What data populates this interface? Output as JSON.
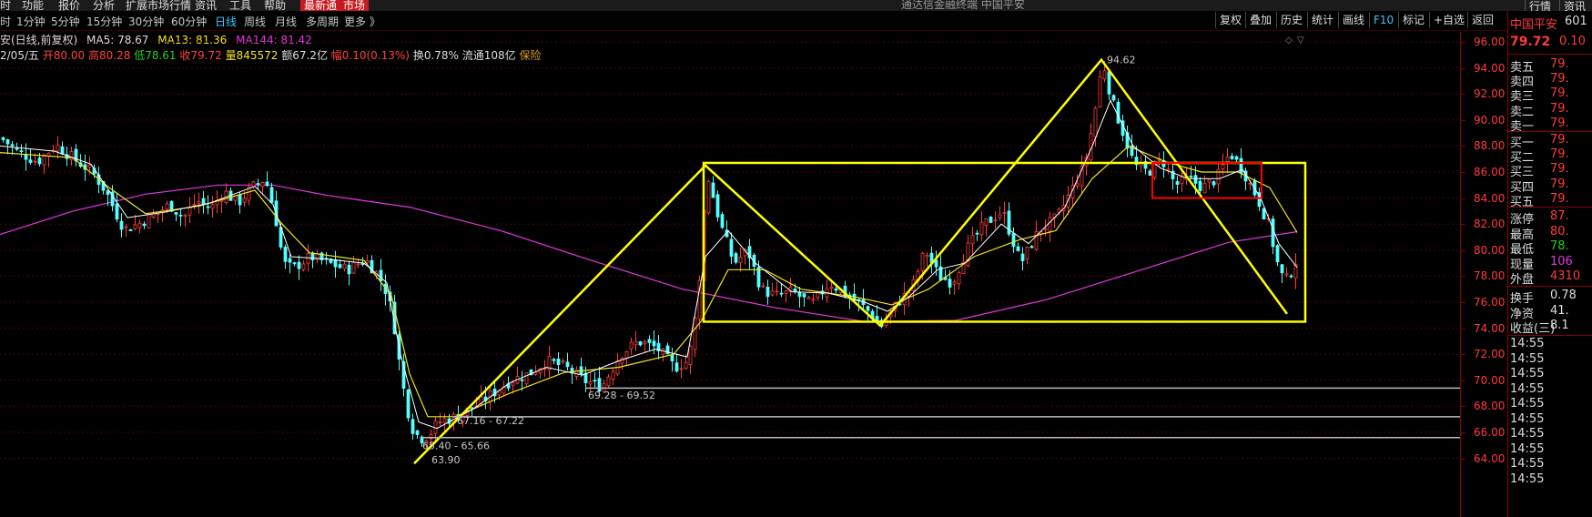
{
  "menubar": {
    "items": [
      "时",
      "功能",
      "报价",
      "分析",
      "扩展市场行情",
      "资讯",
      "工具",
      "帮助"
    ],
    "red_items": [
      "最新通",
      "市场"
    ],
    "window_title": "通达信金融终端 中国平安",
    "right_buttons": [
      "行情",
      "资讯"
    ]
  },
  "toolbar": {
    "periods": [
      "时",
      "1分钟",
      "5分钟",
      "15分钟",
      "30分钟",
      "60分钟",
      "日线",
      "周线",
      "月线",
      "多周期",
      "更多 》"
    ],
    "active_period": "日线",
    "buttons": [
      "复权",
      "叠加",
      "历史",
      "统计",
      "画线",
      "F10",
      "标记",
      "+自选",
      "返回"
    ],
    "f10_color": "#3fc4ff"
  },
  "info_line1": {
    "stock": "安(日线,前复权)",
    "ma5": "MA5: 78.67",
    "ma13": "MA13: 81.36",
    "ma144": "MA144: 81.42"
  },
  "info_line2": {
    "date": "2/05/五",
    "open": "开80.00",
    "high": "高80.28",
    "low": "低78.61",
    "close": "收79.72",
    "volume": "量845572",
    "amount": "额67.2亿",
    "change": "幅0.10(0.13%)",
    "turnover": "换0.78%",
    "float": "流通108亿",
    "sector": "保险"
  },
  "y_axis": {
    "labels": [
      "96.00",
      "94.00",
      "92.00",
      "90.00",
      "88.00",
      "86.00",
      "84.00",
      "82.00",
      "80.00",
      "78.00",
      "76.00",
      "74.00",
      "72.00",
      "70.00",
      "68.00",
      "66.00",
      "64.00"
    ]
  },
  "annotations": {
    "peak": "94.62",
    "range1": "69.28 - 69.52",
    "range2": "67.16 - 67.22",
    "range3": "65.40 - 65.66",
    "low": "63.90"
  },
  "panel": {
    "name": "中国平安",
    "code": "601",
    "price": "79.72",
    "change": "0.10",
    "order_book": [
      {
        "k": "卖五",
        "v": "79."
      },
      {
        "k": "卖四",
        "v": "79."
      },
      {
        "k": "卖三",
        "v": "79."
      },
      {
        "k": "卖二",
        "v": "79."
      },
      {
        "k": "卖一",
        "v": "79."
      },
      {
        "k": "买一",
        "v": "79."
      },
      {
        "k": "买二",
        "v": "79."
      },
      {
        "k": "买三",
        "v": "79."
      },
      {
        "k": "买四",
        "v": "79."
      },
      {
        "k": "买五",
        "v": "79."
      }
    ],
    "stats": [
      {
        "k": "涨停",
        "v": "87."
      },
      {
        "k": "最高",
        "v": "80."
      },
      {
        "k": "最低",
        "v": "78."
      },
      {
        "k": "现量",
        "v": "106"
      },
      {
        "k": "外盘",
        "v": "4310"
      }
    ],
    "stats2": [
      {
        "k": "换手",
        "v": "0.78"
      },
      {
        "k": "净资",
        "v": "41."
      },
      {
        "k": "收益(三)",
        "v": "8.1"
      }
    ],
    "ticks": [
      "14:55",
      "14:55",
      "14:55",
      "14:55",
      "14:55",
      "14:55",
      "14:55",
      "14:55",
      "14:55",
      "14:55"
    ]
  },
  "colors": {
    "background": "#000000",
    "up": "#ff3b3b",
    "down": "#54ffff",
    "ma5": "#ffffff",
    "ma13": "#f2e51c",
    "ma144": "#e03ae0",
    "drawing": "#ffff00",
    "box_red": "#ff0000"
  },
  "chart_data": {
    "type": "candlestick",
    "title": "安(日线,前复权)",
    "ylim": [
      63.5,
      97.0
    ],
    "y_ticks": [
      96,
      94,
      92,
      90,
      88,
      86,
      84,
      82,
      80,
      78,
      76,
      74,
      72,
      70,
      68,
      66,
      64
    ],
    "grid": true,
    "series": [
      {
        "name": "MA5",
        "last": 78.67
      },
      {
        "name": "MA13",
        "last": 81.36
      },
      {
        "name": "MA144",
        "last": 81.42
      }
    ],
    "price_path": [
      [
        0,
        88.6
      ],
      [
        20,
        87.5
      ],
      [
        40,
        86.8
      ],
      [
        60,
        88.1
      ],
      [
        80,
        87.0
      ],
      [
        100,
        86.0
      ],
      [
        115,
        84.5
      ],
      [
        125,
        83.0
      ],
      [
        135,
        81.6
      ],
      [
        150,
        82.0
      ],
      [
        170,
        82.8
      ],
      [
        185,
        83.5
      ],
      [
        200,
        82.5
      ],
      [
        215,
        83.8
      ],
      [
        230,
        83.2
      ],
      [
        245,
        84.5
      ],
      [
        260,
        83.6
      ],
      [
        275,
        84.8
      ],
      [
        290,
        85.5
      ],
      [
        300,
        83.0
      ],
      [
        310,
        79.0
      ],
      [
        320,
        78.6
      ],
      [
        340,
        79.5
      ],
      [
        360,
        79.0
      ],
      [
        380,
        78.5
      ],
      [
        400,
        79.3
      ],
      [
        415,
        78.0
      ],
      [
        425,
        76.5
      ],
      [
        432,
        74.0
      ],
      [
        440,
        70.0
      ],
      [
        450,
        66.5
      ],
      [
        460,
        65.5
      ],
      [
        470,
        65.8
      ],
      [
        480,
        66.8
      ],
      [
        500,
        67.2
      ],
      [
        520,
        68.0
      ],
      [
        540,
        69.0
      ],
      [
        560,
        70.0
      ],
      [
        580,
        70.5
      ],
      [
        600,
        71.5
      ],
      [
        620,
        71.0
      ],
      [
        640,
        70.0
      ],
      [
        660,
        69.5
      ],
      [
        680,
        72.0
      ],
      [
        700,
        73.0
      ],
      [
        720,
        72.5
      ],
      [
        740,
        71.0
      ],
      [
        755,
        71.5
      ],
      [
        765,
        76.0
      ],
      [
        775,
        86.0
      ],
      [
        790,
        82.0
      ],
      [
        805,
        79.0
      ],
      [
        820,
        80.0
      ],
      [
        835,
        77.0
      ],
      [
        850,
        76.5
      ],
      [
        870,
        76.8
      ],
      [
        890,
        75.8
      ],
      [
        910,
        77.5
      ],
      [
        930,
        76.5
      ],
      [
        950,
        75.5
      ],
      [
        967,
        74.2
      ],
      [
        985,
        76.0
      ],
      [
        1000,
        77.0
      ],
      [
        1015,
        80.0
      ],
      [
        1030,
        78.0
      ],
      [
        1045,
        77.5
      ],
      [
        1060,
        80.0
      ],
      [
        1080,
        82.0
      ],
      [
        1100,
        83.0
      ],
      [
        1120,
        79.0
      ],
      [
        1140,
        81.5
      ],
      [
        1160,
        82.5
      ],
      [
        1175,
        84.5
      ],
      [
        1190,
        86.5
      ],
      [
        1200,
        90.0
      ],
      [
        1210,
        94.6
      ],
      [
        1220,
        91.5
      ],
      [
        1230,
        89.5
      ],
      [
        1245,
        86.5
      ],
      [
        1260,
        86.0
      ],
      [
        1275,
        87.0
      ],
      [
        1290,
        85.0
      ],
      [
        1305,
        85.5
      ],
      [
        1320,
        84.8
      ],
      [
        1335,
        85.5
      ],
      [
        1350,
        87.5
      ],
      [
        1365,
        86.0
      ],
      [
        1380,
        84.0
      ],
      [
        1392,
        82.0
      ],
      [
        1402,
        79.0
      ],
      [
        1410,
        77.5
      ],
      [
        1418,
        78.5
      ],
      [
        1425,
        79.72
      ]
    ],
    "ma5_path": [
      [
        0,
        88.0
      ],
      [
        60,
        87.6
      ],
      [
        100,
        86.6
      ],
      [
        140,
        82.5
      ],
      [
        180,
        82.9
      ],
      [
        230,
        83.6
      ],
      [
        280,
        84.9
      ],
      [
        300,
        83.5
      ],
      [
        320,
        79.5
      ],
      [
        360,
        79.3
      ],
      [
        400,
        79.0
      ],
      [
        425,
        77.5
      ],
      [
        440,
        72.0
      ],
      [
        460,
        66.8
      ],
      [
        480,
        66.3
      ],
      [
        520,
        67.8
      ],
      [
        560,
        69.8
      ],
      [
        600,
        71.0
      ],
      [
        640,
        70.4
      ],
      [
        680,
        71.5
      ],
      [
        720,
        72.4
      ],
      [
        755,
        71.8
      ],
      [
        775,
        79.5
      ],
      [
        800,
        81.5
      ],
      [
        830,
        79.0
      ],
      [
        870,
        76.8
      ],
      [
        910,
        76.7
      ],
      [
        950,
        76.0
      ],
      [
        975,
        75.3
      ],
      [
        1000,
        76.5
      ],
      [
        1030,
        78.5
      ],
      [
        1060,
        79.0
      ],
      [
        1100,
        82.0
      ],
      [
        1130,
        80.5
      ],
      [
        1170,
        83.3
      ],
      [
        1200,
        88.0
      ],
      [
        1220,
        91.5
      ],
      [
        1245,
        88.0
      ],
      [
        1275,
        86.3
      ],
      [
        1305,
        85.5
      ],
      [
        1340,
        85.5
      ],
      [
        1365,
        86.2
      ],
      [
        1385,
        84.0
      ],
      [
        1405,
        80.5
      ],
      [
        1425,
        78.67
      ]
    ],
    "ma13_path": [
      [
        0,
        87.5
      ],
      [
        80,
        87.1
      ],
      [
        120,
        84.8
      ],
      [
        160,
        82.8
      ],
      [
        220,
        83.4
      ],
      [
        280,
        84.6
      ],
      [
        310,
        82.0
      ],
      [
        340,
        79.8
      ],
      [
        400,
        79.2
      ],
      [
        430,
        76.5
      ],
      [
        450,
        70.5
      ],
      [
        470,
        67.2
      ],
      [
        500,
        67.2
      ],
      [
        560,
        69.0
      ],
      [
        620,
        70.6
      ],
      [
        680,
        71.0
      ],
      [
        740,
        72.0
      ],
      [
        770,
        74.5
      ],
      [
        800,
        78.5
      ],
      [
        840,
        78.5
      ],
      [
        880,
        77.0
      ],
      [
        940,
        76.4
      ],
      [
        980,
        75.8
      ],
      [
        1020,
        77.0
      ],
      [
        1070,
        79.5
      ],
      [
        1120,
        80.8
      ],
      [
        1160,
        81.5
      ],
      [
        1200,
        85.5
      ],
      [
        1240,
        88.0
      ],
      [
        1280,
        86.8
      ],
      [
        1320,
        86.0
      ],
      [
        1360,
        86.0
      ],
      [
        1395,
        84.8
      ],
      [
        1425,
        81.36
      ]
    ],
    "ma144_path": [
      [
        0,
        81.2
      ],
      [
        80,
        83.0
      ],
      [
        160,
        84.3
      ],
      [
        240,
        85.0
      ],
      [
        300,
        85.0
      ],
      [
        360,
        84.2
      ],
      [
        450,
        83.3
      ],
      [
        550,
        81.5
      ],
      [
        650,
        79.2
      ],
      [
        750,
        77.0
      ],
      [
        850,
        75.6
      ],
      [
        950,
        74.5
      ],
      [
        1050,
        74.6
      ],
      [
        1150,
        76.2
      ],
      [
        1250,
        78.4
      ],
      [
        1350,
        80.6
      ],
      [
        1425,
        81.42
      ]
    ],
    "drawings": {
      "zigzag": [
        [
          455,
          63.6
        ],
        [
          775,
          86.5
        ],
        [
          967,
          74.2
        ],
        [
          1210,
          94.62
        ],
        [
          1414,
          75.1
        ]
      ],
      "box": {
        "x1": 773,
        "x2": 1434,
        "top": 86.7,
        "bottom": 74.5
      },
      "red_box": {
        "x1": 1266,
        "x2": 1386,
        "top": 86.7,
        "bottom": 84.0
      },
      "support_lines": [
        {
          "x1": 643,
          "price": 69.4
        },
        {
          "x1": 498,
          "price": 67.2
        },
        {
          "x1": 462,
          "price": 65.6
        }
      ]
    }
  }
}
